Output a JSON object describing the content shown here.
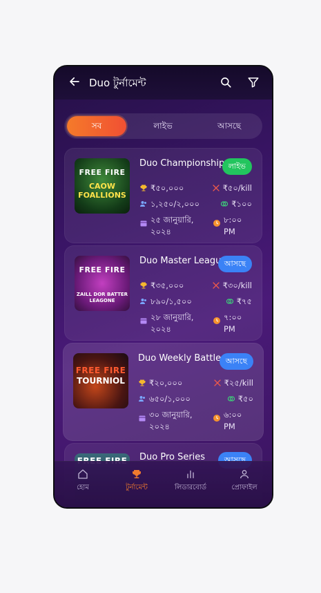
{
  "header": {
    "title": "Duo টুর্নামেন্ট"
  },
  "tabs": [
    {
      "label": "সব",
      "active": true
    },
    {
      "label": "লাইভ",
      "active": false
    },
    {
      "label": "আসছে",
      "active": false
    }
  ],
  "tournaments": [
    {
      "name": "Duo Championship",
      "status": "লাইভ",
      "status_color": "#22c55e",
      "prize": "₹৫০,০০০",
      "per_kill": "₹৫০/kill",
      "players": "১,২৫০/২,০০০",
      "entry_fee": "₹১০০",
      "date": "২৫ জানুয়ারি, ২০২৪",
      "time": "৮:০০ PM",
      "thumb_line1": "FREE FIRE",
      "thumb_line2": "CAOW FOALLIONS"
    },
    {
      "name": "Duo Master League",
      "status": "আসছে",
      "status_color": "#3b82f6",
      "prize": "₹৩৫,০০০",
      "per_kill": "₹৩০/kill",
      "players": "৮৯০/১,৫০০",
      "entry_fee": "₹৭৫",
      "date": "২৮ জানুয়ারি, ২০২৪",
      "time": "৭:০০ PM",
      "thumb_line1": "FREE FIRE",
      "thumb_line2": "ZAILL DOR BATTER LEAGONE"
    },
    {
      "name": "Duo Weekly Battle",
      "status": "আসছে",
      "status_color": "#3b82f6",
      "prize": "₹২০,০০০",
      "per_kill": "₹২৫/kill",
      "players": "৬৫০/১,০০০",
      "entry_fee": "₹৫০",
      "date": "৩০ জানুয়ারি, ২০২৪",
      "time": "৬:০০ PM",
      "thumb_line1": "FREE FIRE",
      "thumb_line2": "TOURNIOL"
    },
    {
      "name": "Duo Pro Series",
      "status": "আসছে",
      "status_color": "#3b82f6",
      "thumb_line1": "FREE FIRE"
    }
  ],
  "bottom_nav": [
    {
      "label": "হোম",
      "icon": "home-icon",
      "active": false
    },
    {
      "label": "টুর্নামেন্ট",
      "icon": "trophy-icon",
      "active": true
    },
    {
      "label": "লিডারবোর্ড",
      "icon": "leaderboard-icon",
      "active": false
    },
    {
      "label": "প্রোফাইল",
      "icon": "profile-icon",
      "active": false
    }
  ],
  "colors": {
    "accent": "#f07a2e",
    "live": "#22c55e",
    "upcoming": "#3b82f6",
    "bg": "#3a1566"
  }
}
